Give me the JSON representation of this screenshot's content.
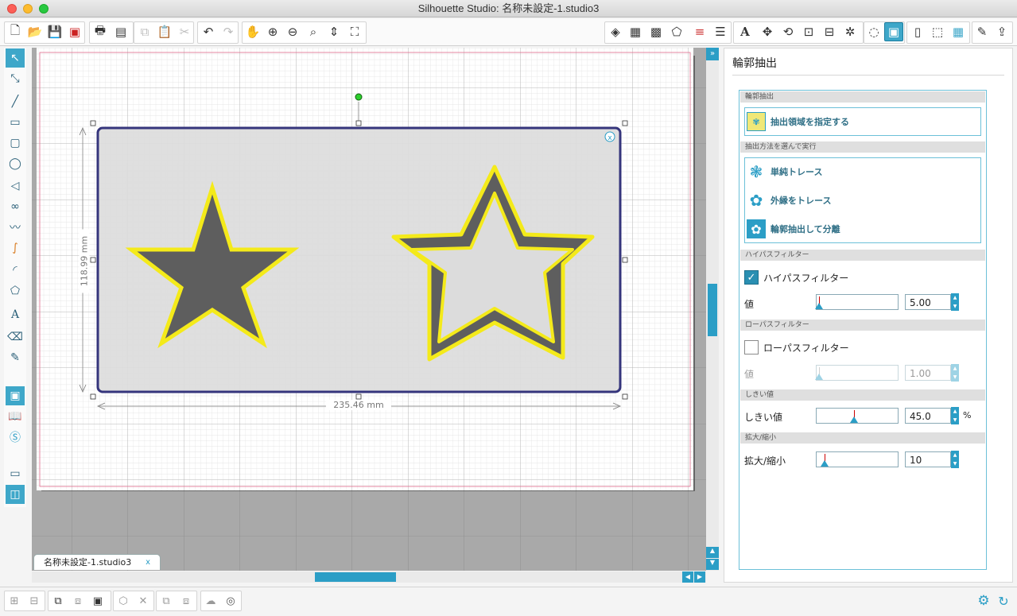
{
  "window": {
    "title": "Silhouette Studio: 名称未設定-1.studio3"
  },
  "toolbar_icons_left": [
    "new-document",
    "open-folder",
    "save",
    "save-as",
    "print",
    "print-cut",
    "copy",
    "paste",
    "cut",
    "undo",
    "redo",
    "pan-hand",
    "zoom-in",
    "zoom-out",
    "zoom-select",
    "zoom-fit-drag",
    "zoom-fit-page"
  ],
  "toolbar_icons_right": [
    "fill-color",
    "gradient",
    "pattern",
    "line-style",
    "line-color",
    "line-settings",
    "text-style",
    "replicate",
    "transform",
    "align",
    "scale",
    "rotate",
    "modify",
    "offset",
    "trace",
    "page-setup",
    "cut-settings",
    "cutter",
    "send-to"
  ],
  "document": {
    "tab_label": "名称未設定-1.studio3",
    "width_dim": "235.46 mm",
    "height_dim": "118.99 mm"
  },
  "panel": {
    "title": "輪郭抽出",
    "sec_extract": "輪郭抽出",
    "select_area_label": "抽出領域を指定する",
    "sec_method": "抽出方法を選んで実行",
    "methods": [
      "単純トレース",
      "外縁をトレース",
      "輪郭抽出して分離"
    ],
    "sec_highpass": "ハイパスフィルター",
    "highpass_label": "ハイパスフィルター",
    "highpass_checked": true,
    "highpass_value_label": "値",
    "highpass_value": "5.00",
    "sec_lowpass": "ローパスフィルター",
    "lowpass_label": "ローパスフィルター",
    "lowpass_checked": false,
    "lowpass_value_label": "値",
    "lowpass_value": "1.00",
    "sec_threshold": "しきい値",
    "threshold_label": "しきい値",
    "threshold_value": "45.0",
    "threshold_unit": "%",
    "sec_scale": "拡大/縮小",
    "scale_label": "拡大/縮小",
    "scale_value": "10"
  },
  "colors": {
    "accent": "#3ea7c9",
    "trace_yellow": "#f4ea1a",
    "star_fill": "#5e5e5e",
    "selection_frame": "#3b3b82"
  }
}
